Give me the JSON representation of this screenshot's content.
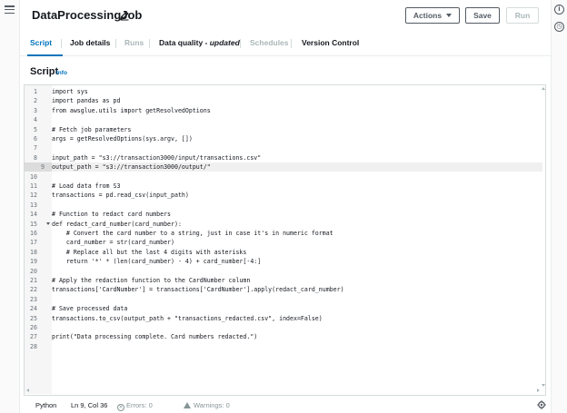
{
  "header": {
    "job_title": "DataProcessingJob",
    "actions_label": "Actions",
    "save_label": "Save",
    "run_label": "Run"
  },
  "tabs": [
    {
      "label": "Script",
      "state": "active"
    },
    {
      "label": "Job details",
      "state": "normal"
    },
    {
      "label": "Runs",
      "state": "disabled"
    },
    {
      "label": "Data quality - ",
      "suffix": "updated",
      "state": "normal"
    },
    {
      "label": "Schedules",
      "state": "disabled"
    },
    {
      "label": "Version Control",
      "state": "normal"
    }
  ],
  "section": {
    "title": "Script",
    "info": "Info"
  },
  "editor": {
    "active_line": 9,
    "fold_line": 15,
    "lines": [
      "import sys",
      "import pandas as pd",
      "from awsglue.utils import getResolvedOptions",
      "",
      "# Fetch job parameters",
      "args = getResolvedOptions(sys.argv, [])",
      "",
      "input_path = \"s3://transaction3000/input/transactions.csv\"",
      "output_path = \"s3://transaction3000/output/\"",
      "",
      "# Load data from S3",
      "transactions = pd.read_csv(input_path)",
      "",
      "# Function to redact card numbers",
      "def redact_card_number(card_number):",
      "    # Convert the card number to a string, just in case it's in numeric format",
      "    card_number = str(card_number)",
      "    # Replace all but the last 4 digits with asterisks",
      "    return '*' * (len(card_number) - 4) + card_number[-4:]",
      "",
      "# Apply the redaction function to the CardNumber column",
      "transactions['CardNumber'] = transactions['CardNumber'].apply(redact_card_number)",
      "",
      "# Save processed data",
      "transactions.to_csv(output_path + \"transactions_redacted.csv\", index=False)",
      "",
      "print(\"Data processing complete. Card numbers redacted.\")",
      ""
    ]
  },
  "status_bar": {
    "language": "Python",
    "position": "Ln 9, Col 36",
    "errors": "Errors: 0",
    "warnings": "Warnings: 0"
  },
  "colors": {
    "accent": "#0073bb",
    "text": "#16191f",
    "muted": "#879596",
    "border": "#d5dbdb"
  },
  "icons": [
    "menu-icon",
    "pencil-icon",
    "caret-down-icon",
    "info-icon",
    "clock-icon",
    "error-icon",
    "warning-icon",
    "gear-icon"
  ]
}
